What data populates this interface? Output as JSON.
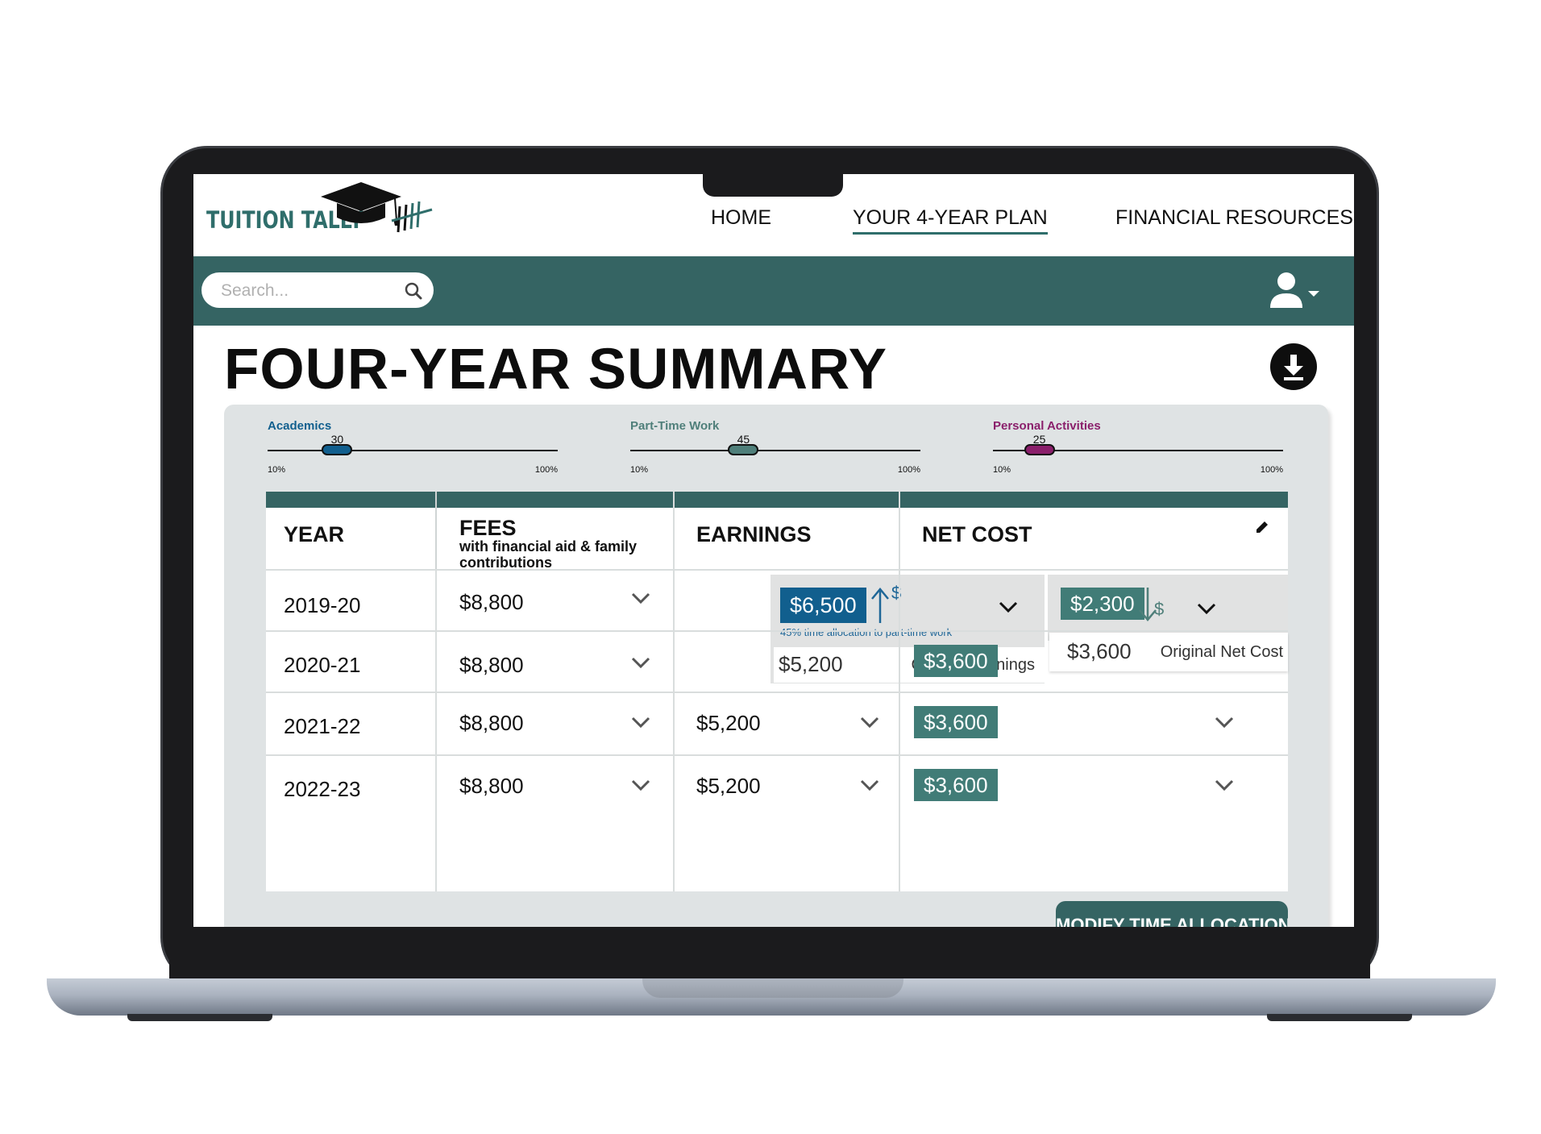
{
  "brand": {
    "name": "TUITION TALLY",
    "logo_icon": "graduation-cap-tally-icon"
  },
  "nav": {
    "items": [
      {
        "label": "HOME"
      },
      {
        "label": "YOUR 4-YEAR PLAN"
      },
      {
        "label": "FINANCIAL RESOURCES"
      }
    ],
    "active": "YOUR 4-YEAR PLAN"
  },
  "search": {
    "placeholder": "Search...",
    "value": ""
  },
  "page": {
    "title": "FOUR-YEAR SUMMARY"
  },
  "colors": {
    "brand_teal": "#356463",
    "academics": "#115f8e",
    "part_time_work": "#4f7f7a",
    "personal_activities": "#8a1f6b",
    "net_badge": "#417c77"
  },
  "sliders": [
    {
      "label": "Academics",
      "value": 30,
      "min_label": "10%",
      "max_label": "100%",
      "level_fraction": 0.24,
      "color": "#115f8e"
    },
    {
      "label": "Part-Time Work",
      "value": 45,
      "min_label": "10%",
      "max_label": "100%",
      "level_fraction": 0.39,
      "color": "#4f7f7a"
    },
    {
      "label": "Personal Activities",
      "value": 25,
      "min_label": "10%",
      "max_label": "100%",
      "level_fraction": 0.16,
      "color": "#8a1f6b"
    }
  ],
  "table": {
    "headers": {
      "year": "YEAR",
      "fees": "FEES",
      "fees_sub": "with financial aid & family contributions",
      "earnings": "EARNINGS",
      "net_cost": "NET COST"
    },
    "rows": [
      {
        "year": "2019-20",
        "fees": "$8,800",
        "earnings": "$6,500",
        "net_cost": "$2,300"
      },
      {
        "year": "2020-21",
        "fees": "$8,800",
        "earnings": "",
        "net_cost": "$3,600"
      },
      {
        "year": "2021-22",
        "fees": "$8,800",
        "earnings": "$5,200",
        "net_cost": "$3,600"
      },
      {
        "year": "2022-23",
        "fees": "$8,800",
        "earnings": "$5,200",
        "net_cost": "$3,600"
      }
    ],
    "earnings_detail": {
      "note": "45% time allocation to part-time work",
      "original_value": "$5,200",
      "original_label": "Original Earnings",
      "indicator": "$"
    },
    "net_detail": {
      "original_value": "$3,600",
      "original_label": "Original Net Cost",
      "indicator": "$"
    }
  },
  "buttons": {
    "modify": "MODIFY TIME ALLOCATION"
  }
}
